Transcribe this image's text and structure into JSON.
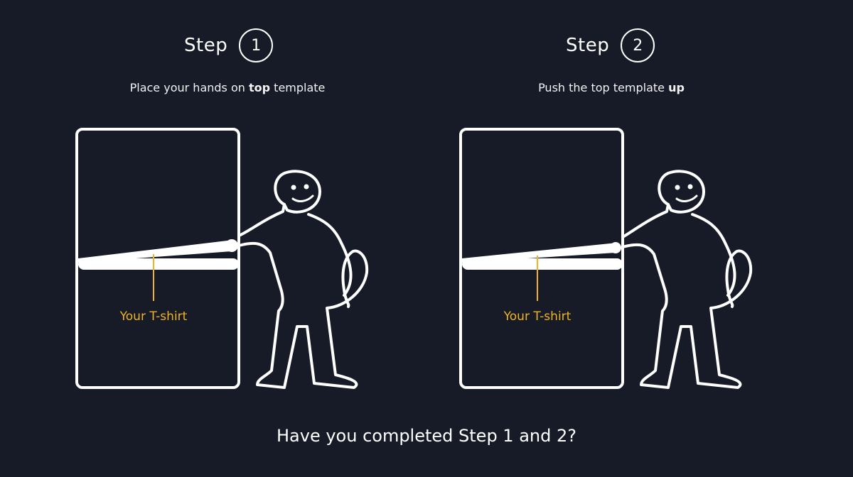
{
  "steps": [
    {
      "word": "Step",
      "number": "1",
      "instruction_pre": "Place your hands on ",
      "instruction_bold": "top",
      "instruction_post": " template",
      "shirt_label": "Your T-shirt"
    },
    {
      "word": "Step",
      "number": "2",
      "instruction_pre": "Push the top template ",
      "instruction_bold": "up",
      "instruction_post": "",
      "shirt_label": "Your T-shirt"
    }
  ],
  "question": "Have you completed Step 1 and 2?",
  "colors": {
    "background": "#161b27",
    "line": "#ffffff",
    "accent": "#f0b323"
  },
  "icons": [
    "stick-figure-icon",
    "folding-board-icon"
  ]
}
